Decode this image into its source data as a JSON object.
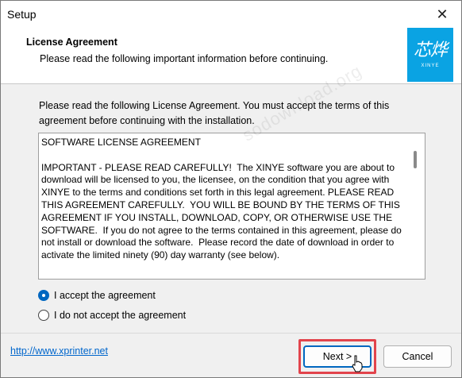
{
  "window": {
    "title": "Setup"
  },
  "header": {
    "title": "License Agreement",
    "subtitle": "Please read the following important information before continuing.",
    "logo": {
      "glyphs": "芯烨",
      "brand": "XINYE"
    }
  },
  "intro": "Please read the following License Agreement. You must accept the terms of this agreement before continuing with the installation.",
  "license_text": "SOFTWARE LICENSE AGREEMENT\n\nIMPORTANT - PLEASE READ CAREFULLY!  The XINYE software you are about to download will be licensed to you, the licensee, on the condition that you agree with XINYE to the terms and conditions set forth in this legal agreement. PLEASE READ THIS AGREEMENT CAREFULLY.  YOU WILL BE BOUND BY THE TERMS OF THIS AGREEMENT IF YOU INSTALL, DOWNLOAD, COPY, OR OTHERWISE USE THE SOFTWARE.  If you do not agree to the terms contained in this agreement, please do not install or download the software.  Please record the date of download in order to activate the limited ninety (90) day warranty (see below).",
  "options": {
    "accept": "I accept the agreement",
    "decline": "I do not accept the agreement",
    "selected": "accept"
  },
  "footer": {
    "link": "http://www.xprinter.net",
    "next": "Next >",
    "cancel": "Cancel"
  },
  "watermark": "sodownload.org",
  "colors": {
    "accent": "#0067c0",
    "logo_bg": "#0aa3e3",
    "highlight": "#e2444c"
  }
}
